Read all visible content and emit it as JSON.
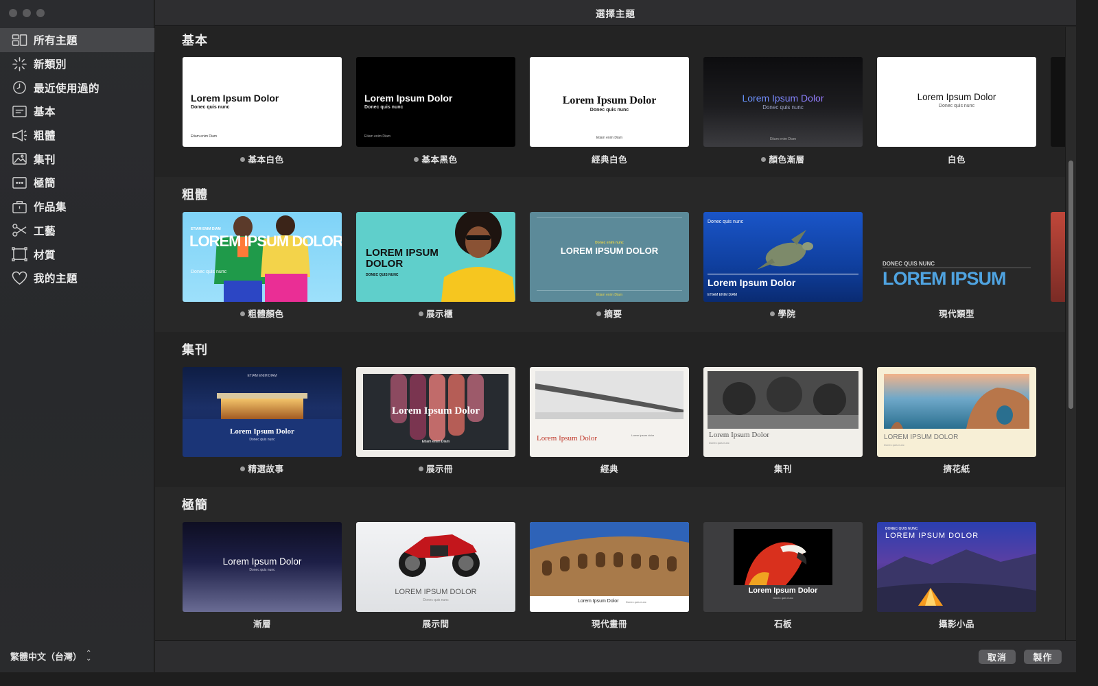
{
  "window": {
    "title": "選擇主題"
  },
  "sidebar": {
    "items": [
      {
        "label": "所有主題",
        "icon": "grid-icon"
      },
      {
        "label": "新類別",
        "icon": "sparkle-icon"
      },
      {
        "label": "最近使用過的",
        "icon": "clock-icon"
      },
      {
        "label": "基本",
        "icon": "text-box-icon"
      },
      {
        "label": "粗體",
        "icon": "megaphone-icon"
      },
      {
        "label": "集刊",
        "icon": "photo-icon"
      },
      {
        "label": "極簡",
        "icon": "ellipsis-box-icon"
      },
      {
        "label": "作品集",
        "icon": "briefcase-icon"
      },
      {
        "label": "工藝",
        "icon": "scissors-icon"
      },
      {
        "label": "材質",
        "icon": "texture-frame-icon"
      },
      {
        "label": "我的主題",
        "icon": "heart-icon"
      }
    ],
    "language": "繁體中文（台灣）"
  },
  "sections": [
    {
      "title": "基本",
      "themes": [
        {
          "name": "基本白色",
          "dot": true,
          "title": "Lorem Ipsum Dolor",
          "sub": "Donec quis nunc",
          "foot": "Etiam enim Diam"
        },
        {
          "name": "基本黑色",
          "dot": true,
          "title": "Lorem Ipsum Dolor",
          "sub": "Donec quis nunc",
          "foot": "Etiam enim Diam"
        },
        {
          "name": "經典白色",
          "dot": false,
          "title": "Lorem Ipsum Dolor",
          "sub": "Donec quis nunc",
          "foot": "Etiam enim Diam"
        },
        {
          "name": "顏色漸層",
          "dot": true,
          "title": "Lorem Ipsum Dolor",
          "sub": "Donec quis nunc",
          "foot": "Etiam enim Diam"
        },
        {
          "name": "白色",
          "dot": false,
          "title": "Lorem Ipsum Dolor",
          "sub": "Donec quis nunc",
          "foot": ""
        }
      ]
    },
    {
      "title": "粗體",
      "themes": [
        {
          "name": "粗體顏色",
          "dot": true,
          "title": "LOREM IPSUM DOLOR",
          "sub": "Donec quis nunc",
          "foot": "ETIAM ENIM DIAM"
        },
        {
          "name": "展示櫃",
          "dot": true,
          "title": "LOREM IPSUM DOLOR",
          "sub": "DONEC QUIS NUNC",
          "foot": ""
        },
        {
          "name": "摘要",
          "dot": true,
          "title": "LOREM IPSUM DOLOR",
          "sub": "Donec enim nunc",
          "foot": "Etiam enim Diam"
        },
        {
          "name": "學院",
          "dot": true,
          "title": "Lorem Ipsum Dolor",
          "sub": "Donec quis nunc",
          "foot": "ETIAM ENIM DIAM"
        },
        {
          "name": "現代類型",
          "dot": false,
          "title": "LOREM IPSUM",
          "sub": "DONEC QUIS NUNC",
          "foot": ""
        }
      ]
    },
    {
      "title": "集刊",
      "themes": [
        {
          "name": "精選故事",
          "dot": true,
          "title": "Lorem Ipsum Dolor",
          "sub": "Donec quis nunc",
          "foot": "ETIAM ENIM DIAM"
        },
        {
          "name": "展示冊",
          "dot": true,
          "title": "Lorem Ipsum Dolor",
          "sub": "Etiam enim Diam",
          "foot": ""
        },
        {
          "name": "經典",
          "dot": false,
          "title": "Lorem Ipsum Dolor",
          "sub": "Lorem ipsum dolor",
          "foot": ""
        },
        {
          "name": "集刊",
          "dot": false,
          "title": "Lorem Ipsum Dolor",
          "sub": "Donec quis nunc",
          "foot": ""
        },
        {
          "name": "擠花紙",
          "dot": false,
          "title": "LOREM IPSUM DOLOR",
          "sub": "Donec quis nunc",
          "foot": ""
        }
      ]
    },
    {
      "title": "極簡",
      "themes": [
        {
          "name": "漸層",
          "dot": false,
          "title": "Lorem Ipsum Dolor",
          "sub": "Donec quis nunc",
          "foot": ""
        },
        {
          "name": "展示間",
          "dot": false,
          "title": "LOREM IPSUM DOLOR",
          "sub": "Donec quis nunc",
          "foot": ""
        },
        {
          "name": "現代畫冊",
          "dot": false,
          "title": "Lorem Ipsum Dolor",
          "sub": "Donec quis nunc",
          "foot": ""
        },
        {
          "name": "石板",
          "dot": false,
          "title": "Lorem Ipsum Dolor",
          "sub": "Donec quis nunc",
          "foot": ""
        },
        {
          "name": "攝影小品",
          "dot": false,
          "title": "LOREM IPSUM DOLOR",
          "sub": "DONEC QUIS NUNC",
          "foot": ""
        }
      ]
    }
  ],
  "buttons": {
    "cancel": "取消",
    "create": "製作"
  }
}
